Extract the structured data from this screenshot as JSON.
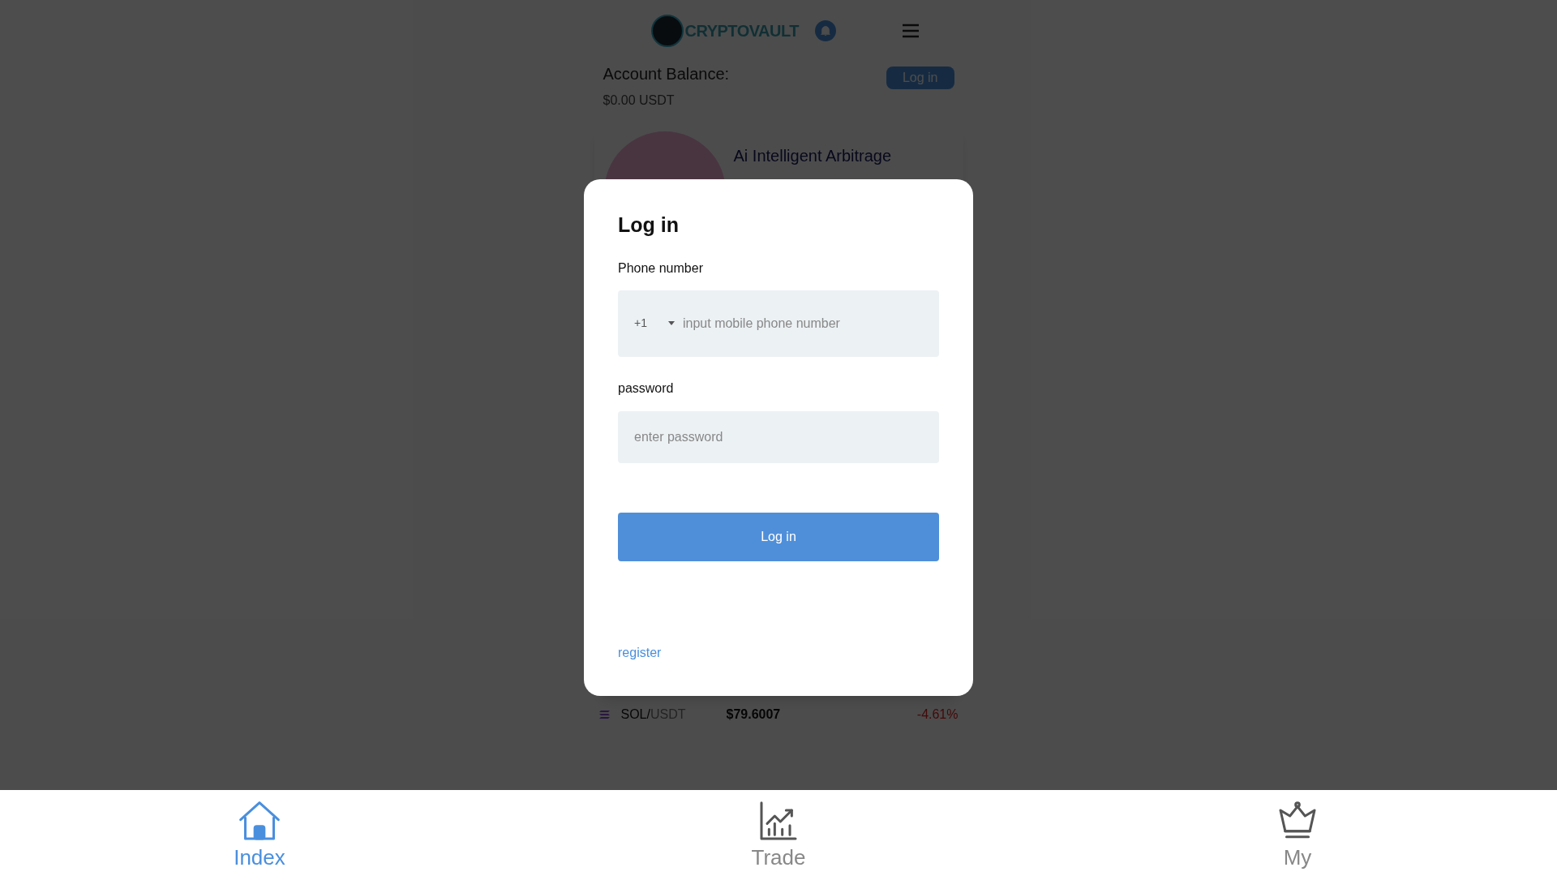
{
  "header": {
    "logo_text": "CRYPTOVAULT"
  },
  "balance": {
    "label": "Account Balance:",
    "value": "$0.00 USDT",
    "login_button": "Log in"
  },
  "card": {
    "title": "Ai Intelligent Arbitrage"
  },
  "markets": [
    {
      "base": "SOL/",
      "quote": "USDT",
      "price": "$79.6007",
      "change": "-4.61%"
    }
  ],
  "login_dialog": {
    "title": "Log in",
    "phone_label": "Phone number",
    "country_code": "+1",
    "phone_placeholder": "input mobile phone number",
    "password_label": "password",
    "password_placeholder": "enter password",
    "submit": "Log in",
    "register_link": "register"
  },
  "nav": [
    {
      "label": "Index",
      "kind": "home",
      "selected": true
    },
    {
      "label": "Trade",
      "kind": "chart",
      "selected": false
    },
    {
      "label": "My",
      "kind": "crown",
      "selected": false
    }
  ]
}
